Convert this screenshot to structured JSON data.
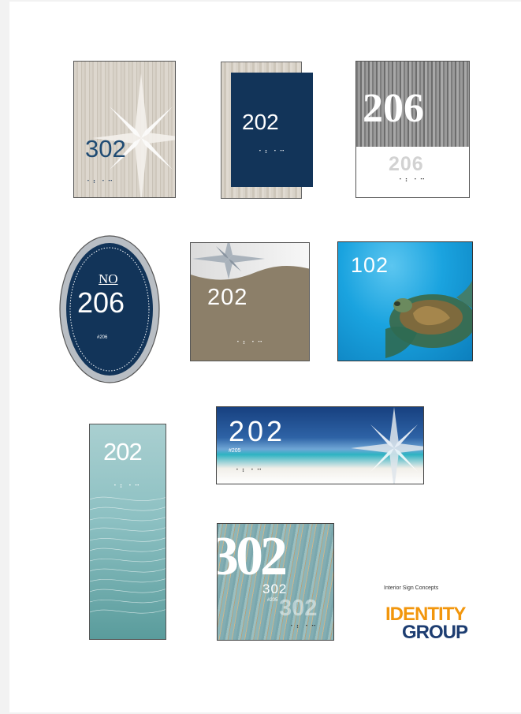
{
  "signs": {
    "s1": {
      "number": "302",
      "braille": "⠁⠃ ⠁⠉"
    },
    "s2": {
      "number": "202",
      "braille": "⠁⠃ ⠁⠉"
    },
    "s3": {
      "number": "206",
      "number_secondary": "206",
      "braille": "⠁⠃ ⠁⠉"
    },
    "s4": {
      "prefix": "NO",
      "number": "206",
      "small": "#206"
    },
    "s5": {
      "number": "202",
      "braille": "⠁⠃ ⠁⠉"
    },
    "s6": {
      "number": "102"
    },
    "s7": {
      "number": "202",
      "braille": "⠁⠃ ⠁⠉"
    },
    "s8": {
      "number": "202",
      "small": "#205",
      "braille": "⠁⠃ ⠁⠉"
    },
    "s9": {
      "big": "302",
      "number": "302",
      "small": "#205",
      "ghost": "302",
      "braille": "⠁⠃ ⠁⠉"
    }
  },
  "caption": "Interior Sign Concepts",
  "logo": {
    "line1": "IDENTITY",
    "line2": "GROUP"
  },
  "colors": {
    "navy": "#123459",
    "logo_orange": "#f2960c",
    "logo_blue": "#1d3d71"
  }
}
